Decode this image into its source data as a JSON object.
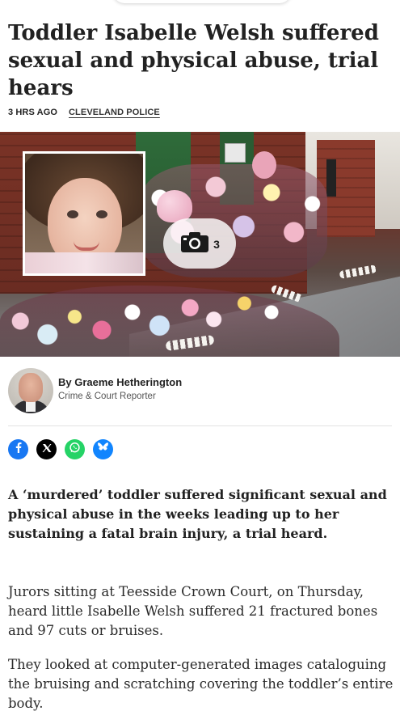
{
  "article": {
    "headline": "Toddler Isabelle Welsh suffered sexual and physical abuse, trial hears",
    "time_ago": "3 HRS AGO",
    "category": "CLEVELAND POLICE"
  },
  "hero": {
    "photo_count": "3",
    "icon": "camera-icon"
  },
  "author": {
    "byline": "By Graeme Hetherington",
    "role": "Crime & Court Reporter"
  },
  "share": {
    "items": [
      {
        "name": "facebook",
        "color": "#1877f2"
      },
      {
        "name": "x",
        "color": "#000000"
      },
      {
        "name": "whatsapp",
        "color": "#25d366"
      },
      {
        "name": "bluesky",
        "color": "#1185fe"
      }
    ]
  },
  "body": {
    "lede": "A ‘murdered’ toddler suffered significant sexual and physical abuse in the weeks leading up to her sustaining a fatal brain injury, a trial heard.",
    "paragraphs": [
      "Jurors sitting at Teesside Crown Court, on Thursday, heard little Isabelle Welsh suffered 21 fractured bones and 97 cuts or bruises.",
      "They looked at computer-generated images cataloguing the bruising and scratching covering the toddler’s entire body."
    ]
  }
}
